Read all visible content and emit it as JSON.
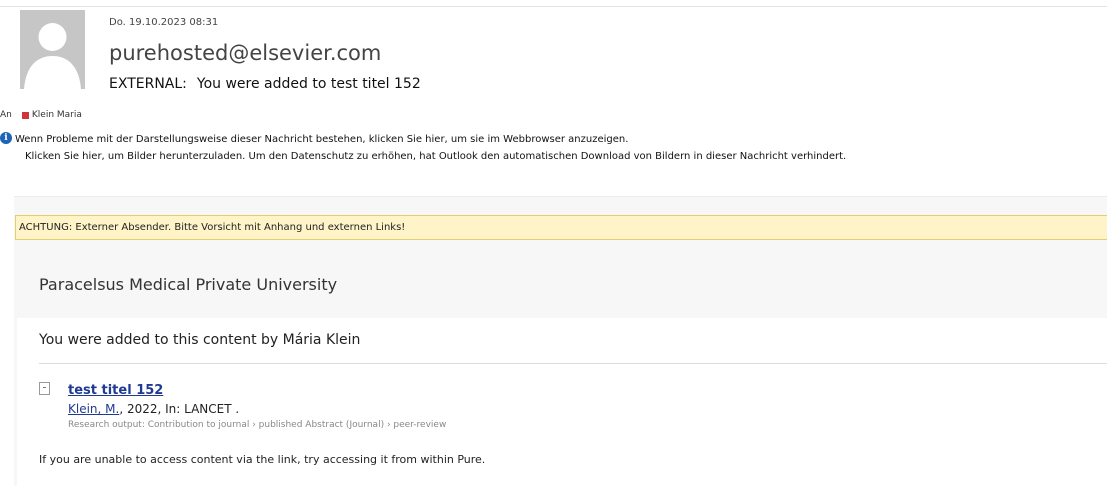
{
  "header": {
    "date": "Do. 19.10.2023 08:31",
    "sender": "purehosted@elsevier.com",
    "subject_prefix": "EXTERNAL:",
    "subject": "You were added to test titel 152",
    "to_label": "An",
    "recipient": "Klein Maria"
  },
  "info": {
    "line1": "Wenn Probleme mit der Darstellungsweise dieser Nachricht bestehen, klicken Sie hier, um sie im Webbrowser anzuzeigen.",
    "line2": "Klicken Sie hier, um Bilder herunterzuladen. Um den Datenschutz zu erhöhen, hat Outlook den automatischen Download von Bildern in dieser Nachricht verhindert."
  },
  "warning": {
    "text": "ACHTUNG: Externer Absender. Bitte Vorsicht mit Anhang und externen Links!",
    "bg_color": "#fff4c8"
  },
  "body": {
    "university": "Paracelsus Medical Private University",
    "added_by": "You were added to this content by Mária Klein",
    "item": {
      "title": "test titel 152",
      "author": "Klein, M.",
      "details": ", 2022, In: LANCET .",
      "type": "Research output: Contribution to journal › published Abstract (Journal) › peer-review"
    },
    "footer": "If you are unable to access content via the link, try accessing it from within Pure."
  },
  "icons": {
    "avatar": "person-silhouette-icon",
    "info": "info-icon",
    "recipient": "contact-status-icon",
    "document": "document-icon"
  },
  "colors": {
    "link": "#1f3a93",
    "info_icon": "#1e63b5",
    "recipient_status": "#d13438"
  }
}
